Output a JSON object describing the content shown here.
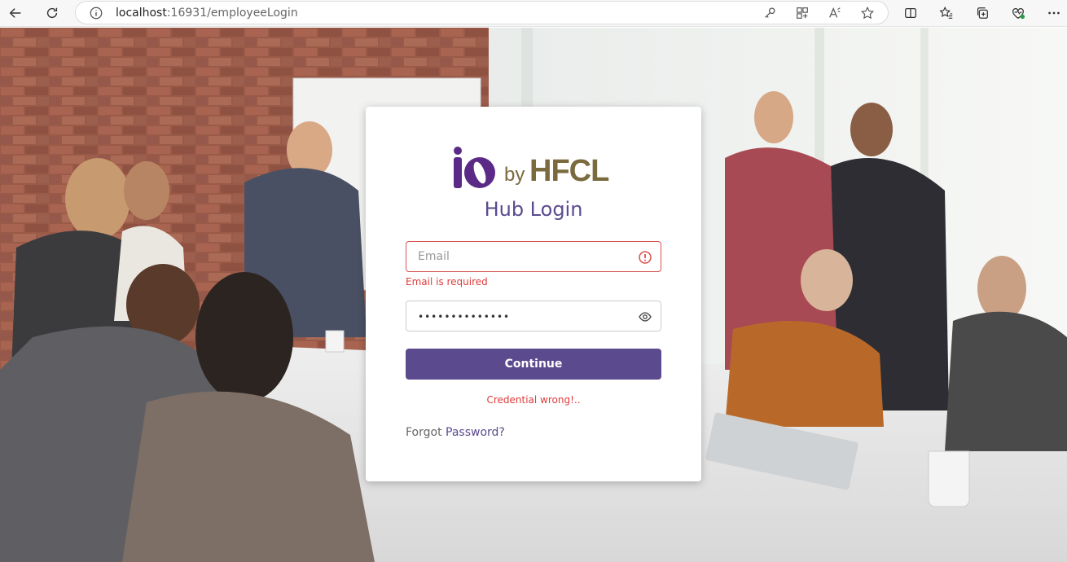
{
  "browser": {
    "url_host": "localhost",
    "url_rest": ":16931/employeeLogin",
    "icons": [
      "back-icon",
      "refresh-icon",
      "info-icon",
      "key-icon",
      "apps-icon",
      "read-aloud-icon",
      "favorite-icon",
      "split-screen-icon",
      "favorites-list-icon",
      "collections-icon",
      "browser-essentials-icon",
      "more-icon"
    ]
  },
  "login": {
    "logo_by": "by",
    "logo_brand": "HFCL",
    "title": "Hub Login",
    "email_placeholder": "Email",
    "email_error": "Email is required",
    "password_value": "••••••••••••••",
    "continue_label": "Continue",
    "credential_error": "Credential wrong!..",
    "forgot_prefix": "Forgot",
    "forgot_link": "Password?"
  },
  "colors": {
    "brand_purple": "#5b4a8e",
    "brand_gold": "#7a6a3e",
    "error_red": "#e03c3c"
  }
}
